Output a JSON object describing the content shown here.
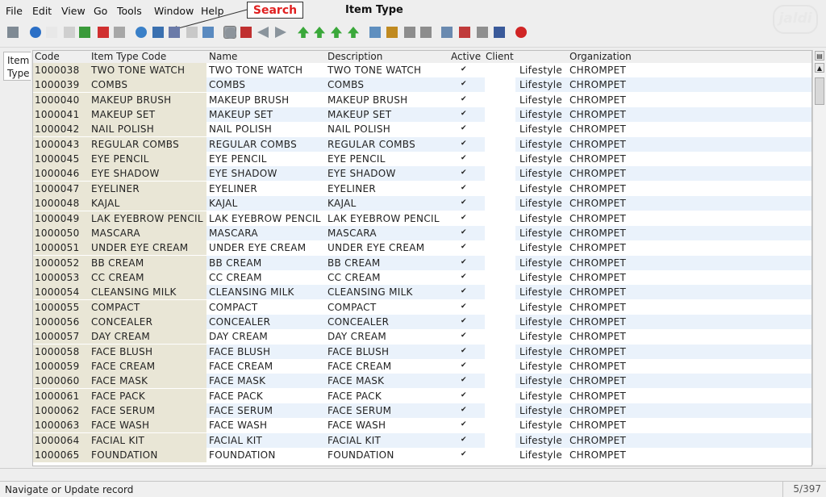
{
  "menu": [
    {
      "label": "File"
    },
    {
      "label": "Edit"
    },
    {
      "label": "View"
    },
    {
      "label": "Go"
    },
    {
      "label": "Tools"
    },
    {
      "label": "Window"
    },
    {
      "label": "Help"
    }
  ],
  "callout": {
    "label": "Search"
  },
  "window_title": "Item Type",
  "logo_text": "jaldi",
  "toolbar_icons": [
    {
      "name": "undo-icon",
      "color": "#7f8a94"
    },
    {
      "name": "help-icon",
      "color": "#2b6fc6"
    },
    {
      "name": "new-record-icon",
      "color": "#e8e8e8"
    },
    {
      "name": "copy-record-icon",
      "color": "#cfcfcf"
    },
    {
      "name": "delete-record-icon",
      "color": "#3a9a3a"
    },
    {
      "name": "delete-icon",
      "color": "#d03030"
    },
    {
      "name": "save-icon",
      "color": "#a7a7a7"
    },
    {
      "name": "refresh-icon",
      "color": "#3a80c8"
    },
    {
      "name": "search-icon",
      "color": "#3a70b0"
    },
    {
      "name": "attachment-icon",
      "color": "#6a7aa8"
    },
    {
      "name": "chat-icon",
      "color": "#c8c8c8"
    },
    {
      "name": "grid-toggle-icon",
      "color": "#5a8ac0"
    },
    {
      "name": "history-icon",
      "color": "#8d949b"
    },
    {
      "name": "home-icon",
      "color": "#c03030"
    },
    {
      "name": "back-icon",
      "color": "#8a949c"
    },
    {
      "name": "forward-icon",
      "color": "#8a949c"
    },
    {
      "name": "first-record-icon",
      "color": "#3aa83a"
    },
    {
      "name": "previous-record-icon",
      "color": "#3aa83a"
    },
    {
      "name": "next-record-icon",
      "color": "#3aa83a"
    },
    {
      "name": "last-record-icon",
      "color": "#3aa83a"
    },
    {
      "name": "report-icon",
      "color": "#5f8fbf"
    },
    {
      "name": "archive-icon",
      "color": "#c08a20"
    },
    {
      "name": "print-preview-icon",
      "color": "#8d8d8d"
    },
    {
      "name": "print-icon",
      "color": "#8d8d8d"
    },
    {
      "name": "zoom-across-icon",
      "color": "#6a8ab0"
    },
    {
      "name": "workflow-icon",
      "color": "#c03a3a"
    },
    {
      "name": "request-icon",
      "color": "#8f8f8f"
    },
    {
      "name": "product-icon",
      "color": "#3a5a9a"
    },
    {
      "name": "close-window-icon",
      "color": "#d02525"
    }
  ],
  "side_tab": {
    "line1": "Item",
    "line2": "Type"
  },
  "columns": {
    "code": "Code",
    "item_type_code": "Item Type Code",
    "name": "Name",
    "description": "Description",
    "active": "Active",
    "client": "Client",
    "organization": "Organization"
  },
  "rows": [
    {
      "code": "1000038",
      "item_type_code": "TWO TONE WATCH",
      "name": "TWO TONE WATCH",
      "description": "TWO TONE WATCH",
      "active": true,
      "client": "Lifestyle",
      "organization": "CHROMPET"
    },
    {
      "code": "1000039",
      "item_type_code": "COMBS",
      "name": "COMBS",
      "description": "COMBS",
      "active": true,
      "client": "Lifestyle",
      "organization": "CHROMPET"
    },
    {
      "code": "1000040",
      "item_type_code": "MAKEUP BRUSH",
      "name": "MAKEUP BRUSH",
      "description": "MAKEUP BRUSH",
      "active": true,
      "client": "Lifestyle",
      "organization": "CHROMPET"
    },
    {
      "code": "1000041",
      "item_type_code": "MAKEUP SET",
      "name": "MAKEUP SET",
      "description": "MAKEUP SET",
      "active": true,
      "client": "Lifestyle",
      "organization": "CHROMPET"
    },
    {
      "code": "1000042",
      "item_type_code": "NAIL POLISH",
      "name": "NAIL POLISH",
      "description": "NAIL POLISH",
      "active": true,
      "client": "Lifestyle",
      "organization": "CHROMPET"
    },
    {
      "code": "1000043",
      "item_type_code": "REGULAR COMBS",
      "name": "REGULAR COMBS",
      "description": "REGULAR COMBS",
      "active": true,
      "client": "Lifestyle",
      "organization": "CHROMPET"
    },
    {
      "code": "1000045",
      "item_type_code": "EYE PENCIL",
      "name": "EYE PENCIL",
      "description": "EYE PENCIL",
      "active": true,
      "client": "Lifestyle",
      "organization": "CHROMPET"
    },
    {
      "code": "1000046",
      "item_type_code": "EYE SHADOW",
      "name": "EYE SHADOW",
      "description": "EYE SHADOW",
      "active": true,
      "client": "Lifestyle",
      "organization": "CHROMPET"
    },
    {
      "code": "1000047",
      "item_type_code": "EYELINER",
      "name": "EYELINER",
      "description": "EYELINER",
      "active": true,
      "client": "Lifestyle",
      "organization": "CHROMPET"
    },
    {
      "code": "1000048",
      "item_type_code": "KAJAL",
      "name": "KAJAL",
      "description": "KAJAL",
      "active": true,
      "client": "Lifestyle",
      "organization": "CHROMPET"
    },
    {
      "code": "1000049",
      "item_type_code": "LAK EYEBROW PENCIL",
      "name": "LAK EYEBROW PENCIL",
      "description": "LAK EYEBROW PENCIL",
      "active": true,
      "client": "Lifestyle",
      "organization": "CHROMPET"
    },
    {
      "code": "1000050",
      "item_type_code": "MASCARA",
      "name": "MASCARA",
      "description": "MASCARA",
      "active": true,
      "client": "Lifestyle",
      "organization": "CHROMPET"
    },
    {
      "code": "1000051",
      "item_type_code": "UNDER EYE CREAM",
      "name": "UNDER EYE CREAM",
      "description": "UNDER EYE CREAM",
      "active": true,
      "client": "Lifestyle",
      "organization": "CHROMPET"
    },
    {
      "code": "1000052",
      "item_type_code": "BB CREAM",
      "name": "BB CREAM",
      "description": "BB CREAM",
      "active": true,
      "client": "Lifestyle",
      "organization": "CHROMPET"
    },
    {
      "code": "1000053",
      "item_type_code": "CC CREAM",
      "name": "CC CREAM",
      "description": "CC CREAM",
      "active": true,
      "client": "Lifestyle",
      "organization": "CHROMPET"
    },
    {
      "code": "1000054",
      "item_type_code": "CLEANSING MILK",
      "name": "CLEANSING MILK",
      "description": "CLEANSING MILK",
      "active": true,
      "client": "Lifestyle",
      "organization": "CHROMPET"
    },
    {
      "code": "1000055",
      "item_type_code": "COMPACT",
      "name": "COMPACT",
      "description": "COMPACT",
      "active": true,
      "client": "Lifestyle",
      "organization": "CHROMPET"
    },
    {
      "code": "1000056",
      "item_type_code": "CONCEALER",
      "name": "CONCEALER",
      "description": "CONCEALER",
      "active": true,
      "client": "Lifestyle",
      "organization": "CHROMPET"
    },
    {
      "code": "1000057",
      "item_type_code": "DAY CREAM",
      "name": "DAY CREAM",
      "description": "DAY CREAM",
      "active": true,
      "client": "Lifestyle",
      "organization": "CHROMPET"
    },
    {
      "code": "1000058",
      "item_type_code": "FACE BLUSH",
      "name": "FACE BLUSH",
      "description": "FACE BLUSH",
      "active": true,
      "client": "Lifestyle",
      "organization": "CHROMPET"
    },
    {
      "code": "1000059",
      "item_type_code": "FACE CREAM",
      "name": "FACE CREAM",
      "description": "FACE CREAM",
      "active": true,
      "client": "Lifestyle",
      "organization": "CHROMPET"
    },
    {
      "code": "1000060",
      "item_type_code": "FACE MASK",
      "name": "FACE MASK",
      "description": "FACE MASK",
      "active": true,
      "client": "Lifestyle",
      "organization": "CHROMPET"
    },
    {
      "code": "1000061",
      "item_type_code": "FACE PACK",
      "name": "FACE PACK",
      "description": "FACE PACK",
      "active": true,
      "client": "Lifestyle",
      "organization": "CHROMPET"
    },
    {
      "code": "1000062",
      "item_type_code": "FACE SERUM",
      "name": "FACE SERUM",
      "description": "FACE SERUM",
      "active": true,
      "client": "Lifestyle",
      "organization": "CHROMPET"
    },
    {
      "code": "1000063",
      "item_type_code": "FACE WASH",
      "name": "FACE WASH",
      "description": "FACE WASH",
      "active": true,
      "client": "Lifestyle",
      "organization": "CHROMPET"
    },
    {
      "code": "1000064",
      "item_type_code": "FACIAL KIT",
      "name": "FACIAL KIT",
      "description": "FACIAL KIT",
      "active": true,
      "client": "Lifestyle",
      "organization": "CHROMPET"
    },
    {
      "code": "1000065",
      "item_type_code": "FOUNDATION",
      "name": "FOUNDATION",
      "description": "FOUNDATION",
      "active": true,
      "client": "Lifestyle",
      "organization": "CHROMPET"
    }
  ],
  "status": {
    "message": "Navigate or Update record",
    "record_count": "5/397"
  },
  "colors": {
    "row_even": "#ffffff",
    "row_odd": "#eaf2fb",
    "code_column": "#e9e6d6",
    "callout_text": "#e02020"
  }
}
